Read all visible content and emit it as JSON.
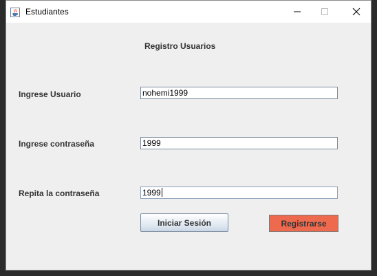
{
  "window": {
    "title": "Estudiantes"
  },
  "form": {
    "heading": "Registro Usuarios",
    "fields": [
      {
        "label": "Ingrese Usuario",
        "value": "nohemi1999"
      },
      {
        "label": "Ingrese contraseña",
        "value": "1999"
      },
      {
        "label": "Repita la contraseña",
        "value": "1999"
      }
    ]
  },
  "buttons": {
    "login_label": "Iniciar Sesión",
    "register_label": "Registrarse"
  },
  "colors": {
    "register_button": "#ee6a4f",
    "window_background": "#f0f0f0",
    "label_text": "#333333"
  },
  "icons": {
    "app": "java-icon",
    "minimize": "minimize-icon",
    "maximize": "maximize-icon",
    "close": "close-icon"
  }
}
